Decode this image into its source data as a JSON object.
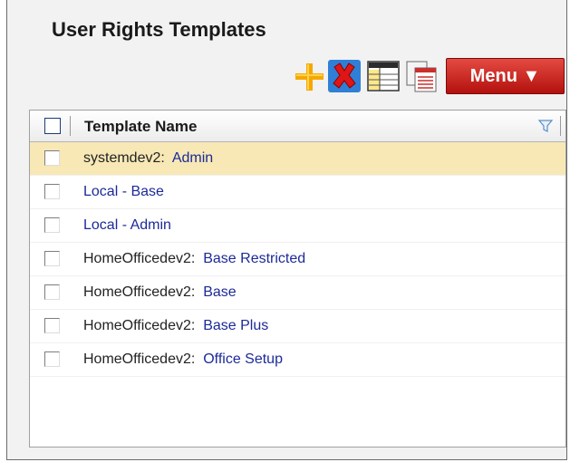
{
  "title": "User Rights Templates",
  "toolbar": {
    "add_icon": "plus-icon",
    "delete_icon": "delete-x-icon",
    "columns_icon": "grid-columns-icon",
    "copy_icon": "copy-pages-icon",
    "menu_label": "Menu ▼",
    "menu_color": "#c81e16"
  },
  "grid": {
    "column_header": "Template Name",
    "rows": [
      {
        "prefix": "systemdev2:  ",
        "name": "Admin",
        "selected": true
      },
      {
        "prefix": "",
        "name": "Local - Base",
        "selected": false
      },
      {
        "prefix": "",
        "name": "Local - Admin",
        "selected": false
      },
      {
        "prefix": "HomeOfficedev2:  ",
        "name": "Base Restricted",
        "selected": false
      },
      {
        "prefix": "HomeOfficedev2:  ",
        "name": "Base",
        "selected": false
      },
      {
        "prefix": "HomeOfficedev2:  ",
        "name": "Base Plus",
        "selected": false
      },
      {
        "prefix": "HomeOfficedev2:  ",
        "name": "Office Setup",
        "selected": false
      }
    ]
  }
}
